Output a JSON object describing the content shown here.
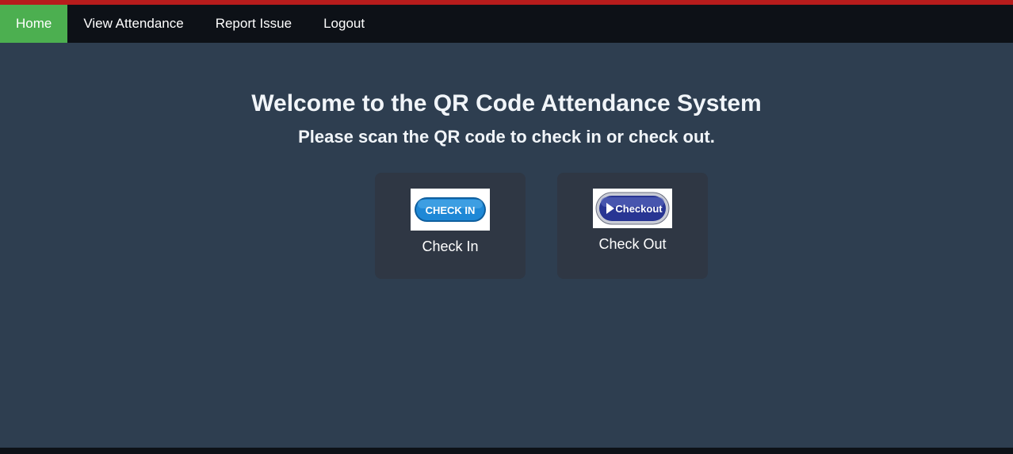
{
  "nav": {
    "items": [
      {
        "label": "Home",
        "active": true
      },
      {
        "label": "View Attendance",
        "active": false
      },
      {
        "label": "Report Issue",
        "active": false
      },
      {
        "label": "Logout",
        "active": false
      }
    ]
  },
  "main": {
    "title": "Welcome to the QR Code Attendance System",
    "subtitle": "Please scan the QR code to check in or check out.",
    "cards": [
      {
        "label": "Check In",
        "image_text": "CHECK IN"
      },
      {
        "label": "Check Out",
        "image_text": "Checkout"
      }
    ]
  },
  "colors": {
    "top_stripe": "#b71c1c",
    "navbar": "#0d1117",
    "active_nav": "#4caf50",
    "background": "#2e3e50",
    "card": "#2f3744",
    "checkin_button": "#1e88d6",
    "checkout_button": "#283593"
  }
}
